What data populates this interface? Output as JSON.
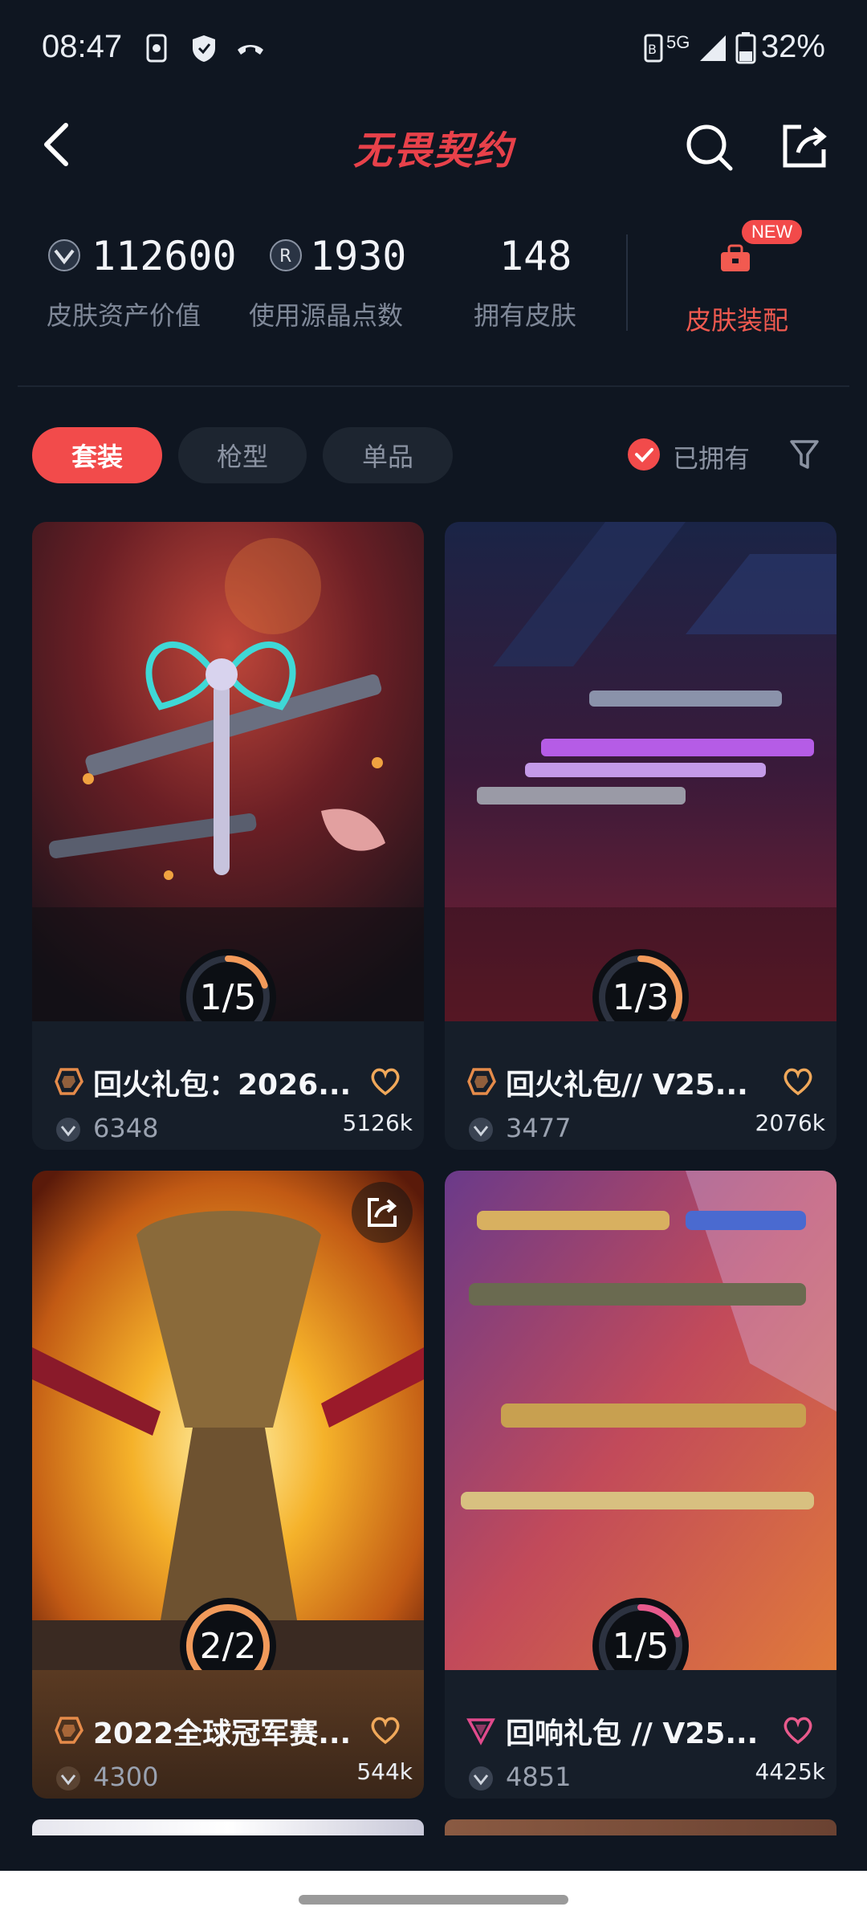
{
  "status_bar": {
    "time": "08:47",
    "battery": "32%",
    "network": "5G"
  },
  "header": {
    "title": "无畏契约"
  },
  "stats": [
    {
      "value": "112600",
      "label": "皮肤资产价值",
      "icon": "vp-coin-icon"
    },
    {
      "value": "1930",
      "label": "使用源晶点数",
      "icon": "radianite-icon"
    },
    {
      "value": "148",
      "label": "拥有皮肤"
    }
  ],
  "wardrobe": {
    "label": "皮肤装配",
    "badge": "NEW"
  },
  "tabs": [
    {
      "label": "套装",
      "active": true
    },
    {
      "label": "枪型",
      "active": false
    },
    {
      "label": "单品",
      "active": false
    }
  ],
  "owned_filter": {
    "label": "已拥有",
    "checked": true
  },
  "cards": [
    {
      "title": "回火礼包：2026...",
      "price": "6348",
      "likes": "5126k",
      "progress": "1/5",
      "progress_fraction": 0.2,
      "tier": "premium",
      "tier_color": "#e58b4a"
    },
    {
      "title": "回火礼包// V25...",
      "price": "3477",
      "likes": "2076k",
      "progress": "1/3",
      "progress_fraction": 0.33,
      "tier": "premium",
      "tier_color": "#e58b4a"
    },
    {
      "title": "2022全球冠军赛...",
      "price": "4300",
      "likes": "544k",
      "progress": "2/2",
      "progress_fraction": 1.0,
      "tier": "premium",
      "tier_color": "#e58b4a"
    },
    {
      "title": "回响礼包 // V25...",
      "price": "4851",
      "likes": "4425k",
      "progress": "1/5",
      "progress_fraction": 0.2,
      "tier": "exclusive",
      "tier_color": "#e04a8c"
    }
  ],
  "colors": {
    "accent": "#f24b4b",
    "background": "#0f1621",
    "progress": "#f29a5a"
  }
}
